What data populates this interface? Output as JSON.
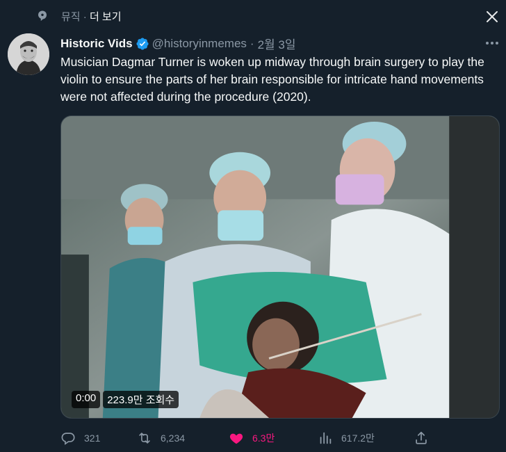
{
  "topic": {
    "label": "뮤직",
    "separator": "·",
    "more": "더 보기"
  },
  "tweet": {
    "display_name": "Historic Vids",
    "handle": "@historyinmemes",
    "separator": "·",
    "date": "2월 3일",
    "text": "Musician Dagmar Turner is woken up midway through brain surgery to play the violin to ensure the parts of her brain responsible for intricate hand movements were not affected during the procedure (2020)."
  },
  "video": {
    "time": "0:00",
    "views": "223.9만 조회수"
  },
  "actions": {
    "replies": "321",
    "retweets": "6,234",
    "likes": "6.3만",
    "views": "617.2만"
  },
  "colors": {
    "accent": "#1d9bf0",
    "like": "#f91880",
    "background": "#15202b",
    "muted": "#8b98a5"
  }
}
